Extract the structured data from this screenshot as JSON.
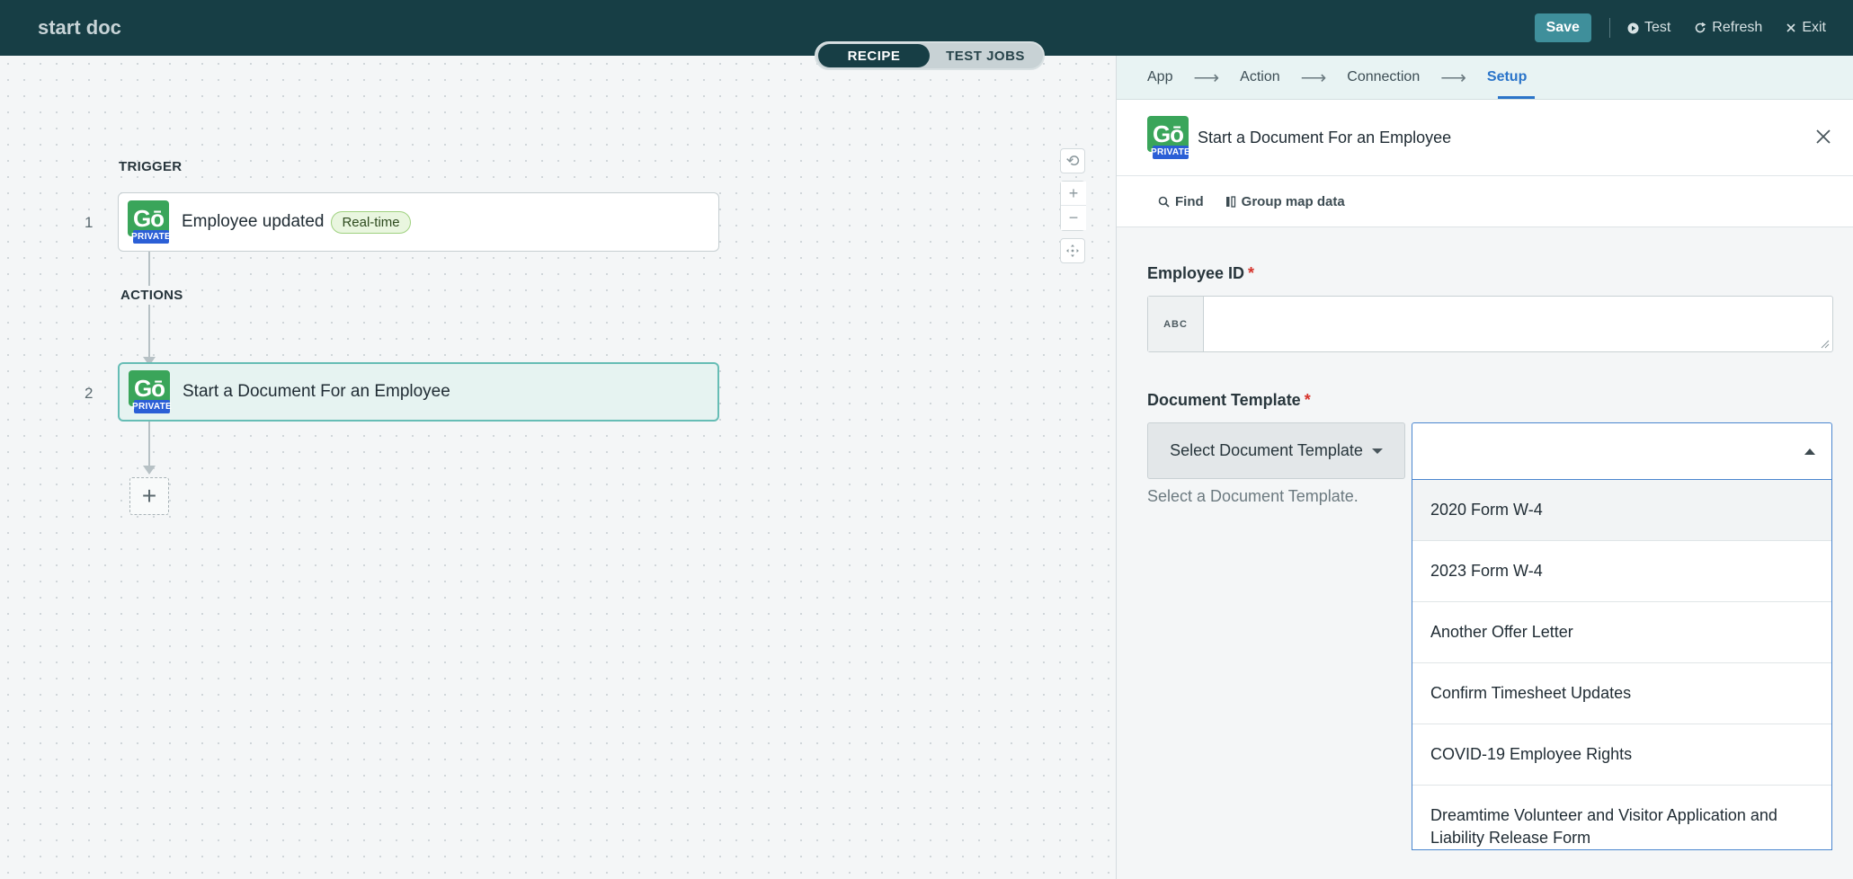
{
  "app": {
    "title": "start doc"
  },
  "topbar": {
    "save_label": "Save",
    "test_label": "Test",
    "refresh_label": "Refresh",
    "exit_label": "Exit"
  },
  "toggle": {
    "recipe_label": "RECIPE",
    "test_jobs_label": "TEST JOBS",
    "active": "RECIPE"
  },
  "canvas": {
    "trigger_label": "TRIGGER",
    "actions_label": "ACTIONS",
    "steps": [
      {
        "number": "1",
        "label": "Employee updated",
        "badge": "Real-time",
        "logo_text": "Gō",
        "logo_badge": "PRIVATE"
      },
      {
        "number": "2",
        "label": "Start a Document For an Employee",
        "logo_text": "Gō",
        "logo_badge": "PRIVATE"
      }
    ],
    "add_step": "+",
    "zoom": {
      "reset_icon": "⟲",
      "zoom_in": "+",
      "zoom_out": "−",
      "fit_icon": "fit-icon"
    }
  },
  "panel": {
    "wizard": [
      {
        "label": "App"
      },
      {
        "label": "Action"
      },
      {
        "label": "Connection"
      },
      {
        "label": "Setup",
        "active": true
      }
    ],
    "header_title": "Start a Document For an Employee",
    "tools": {
      "find_label": "Find",
      "group_label": "Group map data"
    },
    "employee_id": {
      "label": "Employee ID",
      "required_mark": "*",
      "type_tag": "ABC",
      "value": ""
    },
    "document_template": {
      "label": "Document Template",
      "required_mark": "*",
      "select_button_label": "Select Document Template",
      "helper": "Select a Document Template.",
      "value": "",
      "options": [
        "2020 Form W-4",
        "2023 Form W-4",
        "Another Offer Letter",
        "Confirm Timesheet Updates",
        "COVID-19 Employee Rights",
        "Dreamtime Volunteer and Visitor Application and Liability Release Form"
      ]
    }
  },
  "colors": {
    "topbar": "#173e45",
    "save": "#3f8f9b",
    "accent": "#2a74c9",
    "selected_step": "#66bdb5",
    "required": "#d6342c"
  }
}
